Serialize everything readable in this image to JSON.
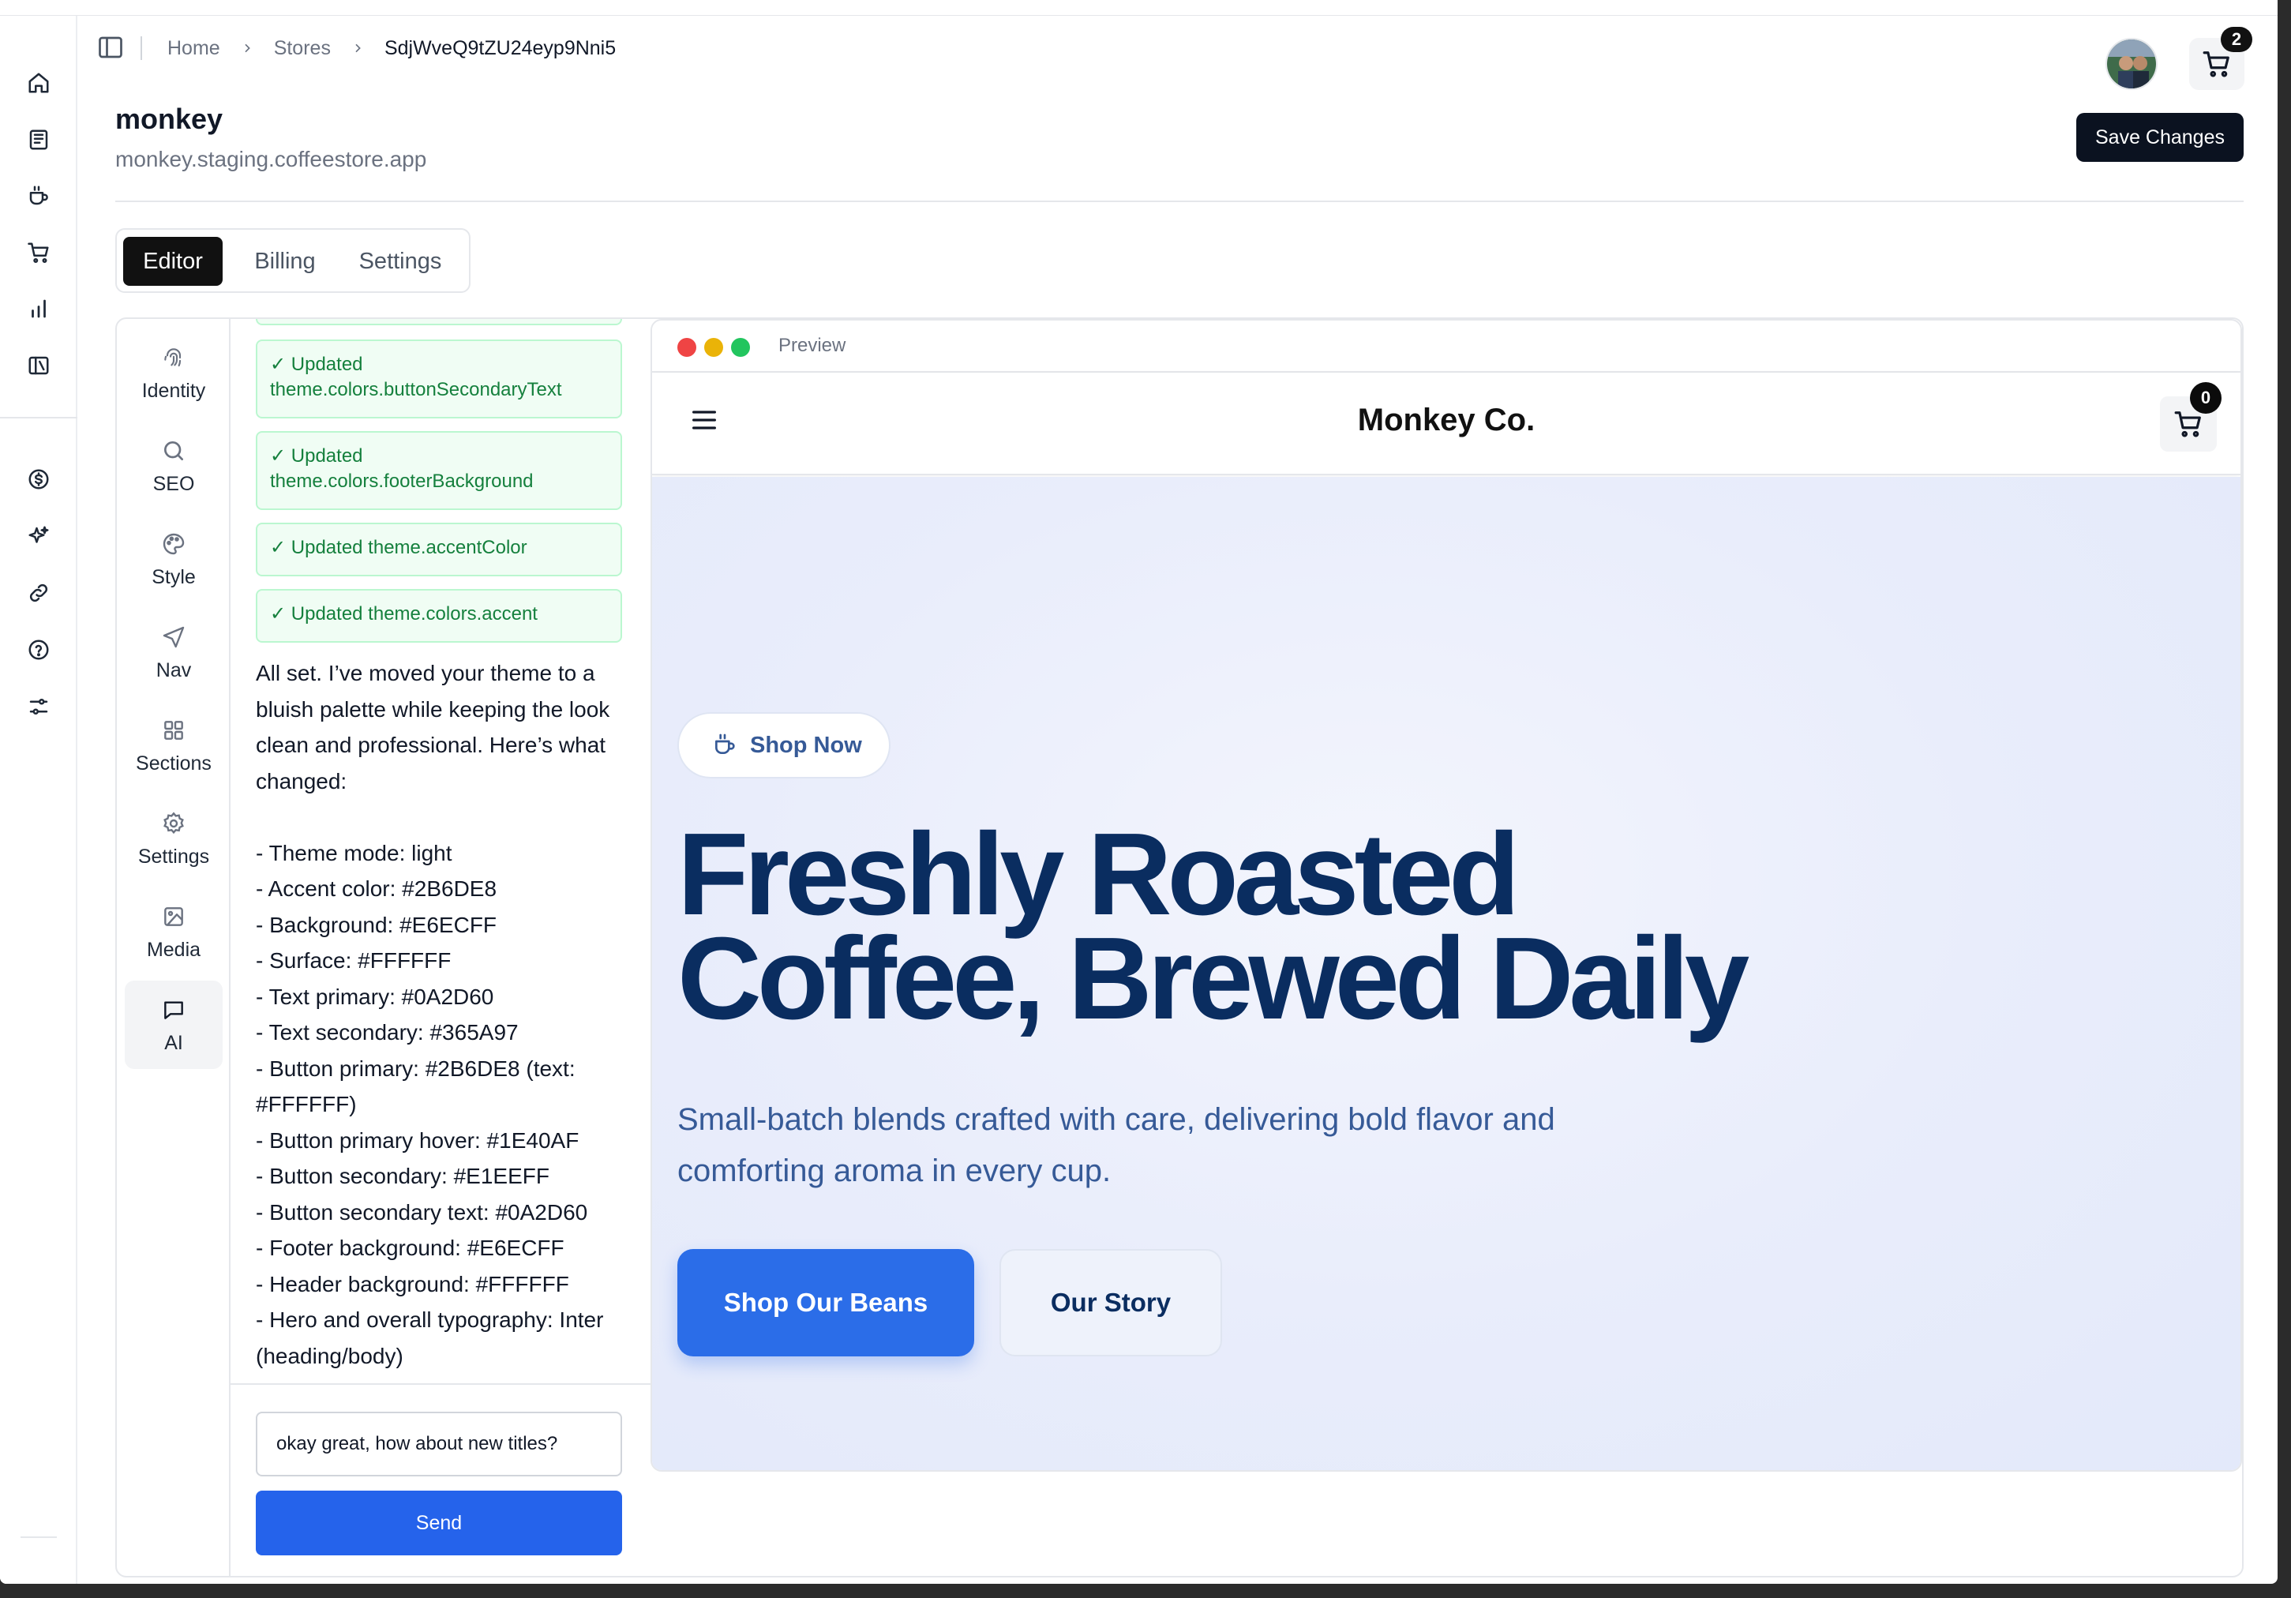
{
  "breadcrumb": [
    "Home",
    "Stores",
    "SdjWveQ9tZU24eyp9Nni5"
  ],
  "header": {
    "cart_count": "2"
  },
  "store": {
    "name": "monkey",
    "domain": "monkey.staging.coffeestore.app",
    "save_label": "Save Changes"
  },
  "tabs": [
    "Editor",
    "Billing",
    "Settings"
  ],
  "active_tab": "Editor",
  "section_nav": [
    {
      "label": "Identity",
      "icon": "fingerprint-icon"
    },
    {
      "label": "SEO",
      "icon": "search-icon"
    },
    {
      "label": "Style",
      "icon": "palette-icon"
    },
    {
      "label": "Nav",
      "icon": "navigation-icon"
    },
    {
      "label": "Sections",
      "icon": "grid-icon"
    },
    {
      "label": "Settings",
      "icon": "gear-icon"
    },
    {
      "label": "Media",
      "icon": "image-icon"
    },
    {
      "label": "AI",
      "icon": "chat-icon"
    }
  ],
  "chat": {
    "updates": [
      "✓ Updated theme.colors.buttonSecondaryText",
      "✓ Updated theme.colors.footerBackground",
      "✓ Updated theme.accentColor",
      "✓ Updated theme.colors.accent"
    ],
    "message": "All set. I’ve moved your theme to a bluish palette while keeping the look clean and professional. Here’s what changed:\n\n- Theme mode: light\n- Accent color: #2B6DE8\n- Background: #E6ECFF\n- Surface: #FFFFFF\n- Text primary: #0A2D60\n- Text secondary: #365A97\n- Button primary: #2B6DE8 (text: #FFFFFF)\n- Button primary hover: #1E40AF\n- Button secondary: #E1EEFF\n- Button secondary text: #0A2D60\n- Footer background: #E6ECFF\n- Header background: #FFFFFF\n- Hero and overall typography: Inter (heading/body)",
    "input_value": "okay great, how about new titles?",
    "send_label": "Send"
  },
  "preview": {
    "label": "Preview",
    "brand": "Monkey Co.",
    "cart_count": "0",
    "pill_label": "Shop Now",
    "hero_title_line1": "Freshly Roasted",
    "hero_title_line2": "Coffee, Brewed Daily",
    "hero_subtitle": "Small-batch blends crafted with care, delivering bold flavor and comforting aroma in every cup.",
    "primary_cta": "Shop Our Beans",
    "secondary_cta": "Our Story"
  },
  "colors": {
    "accent": "#2B6DE8",
    "text_primary": "#0A2D60",
    "text_secondary": "#365A97",
    "save_button": "#0B1220",
    "send_button": "#2563EB",
    "update_card_text": "#15803D"
  }
}
